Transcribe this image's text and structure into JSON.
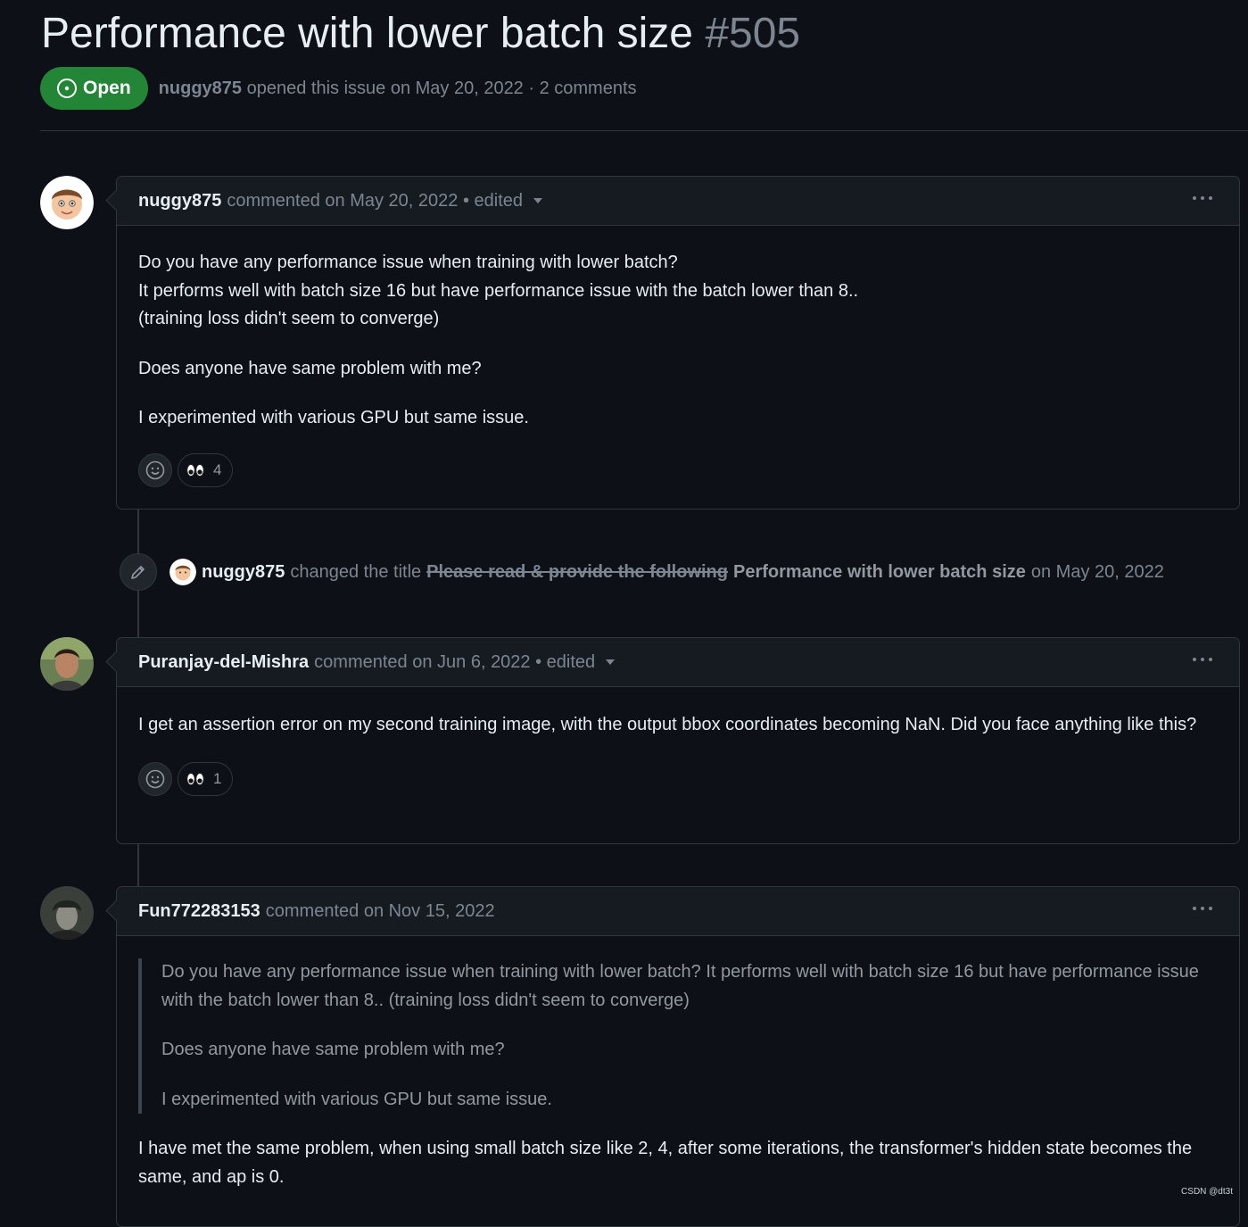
{
  "issue": {
    "title": "Performance with lower batch size",
    "number": "#505",
    "state": "Open",
    "author": "nuggy875",
    "meta": "opened this issue on May 20, 2022 · 2 comments"
  },
  "comments": [
    {
      "author": "nuggy875",
      "header": "commented on May 20, 2022 • edited",
      "paragraphs": [
        "Do you have any performance issue when training with lower batch?",
        "It performs well with batch size 16 but have performance issue with the batch lower than 8..",
        "(training loss didn't seem to converge)",
        "Does anyone have same problem with me?",
        "I experimented with various GPU but same issue."
      ],
      "reaction_count": "4"
    },
    {
      "author": "Puranjay-del-Mishra",
      "header": "commented on Jun 6, 2022 • edited",
      "paragraphs": [
        "I get an assertion error on my second training image, with the output bbox coordinates becoming NaN. Did you face anything like this?"
      ],
      "reaction_count": "1"
    },
    {
      "author": "Fun772283153",
      "header": "commented on Nov 15, 2022",
      "quote": [
        "Do you have any performance issue when training with lower batch? It performs well with batch size 16 but have performance issue with the batch lower than 8.. (training loss didn't seem to converge)",
        "Does anyone have same problem with me?",
        "I experimented with various GPU but same issue."
      ],
      "paragraphs": [
        "I have met the same problem, when using small batch size like 2, 4, after some iterations, the transformer's hidden state becomes the same, and ap is 0."
      ]
    }
  ],
  "title_change": {
    "author": "nuggy875",
    "action": "changed the title",
    "old_title": "Please read & provide the following",
    "new_title": "Performance with lower batch size",
    "date": "on May 20, 2022"
  },
  "watermark": "CSDN @dt3t",
  "colors": {
    "background": "#0d1117",
    "open_badge": "#238636",
    "header_bg": "#161b22",
    "border": "#30363d"
  },
  "icons": [
    "issue-open-icon",
    "smiley-icon",
    "eyes-icon",
    "pencil-icon",
    "kebab-icon",
    "caret-down-icon"
  ]
}
